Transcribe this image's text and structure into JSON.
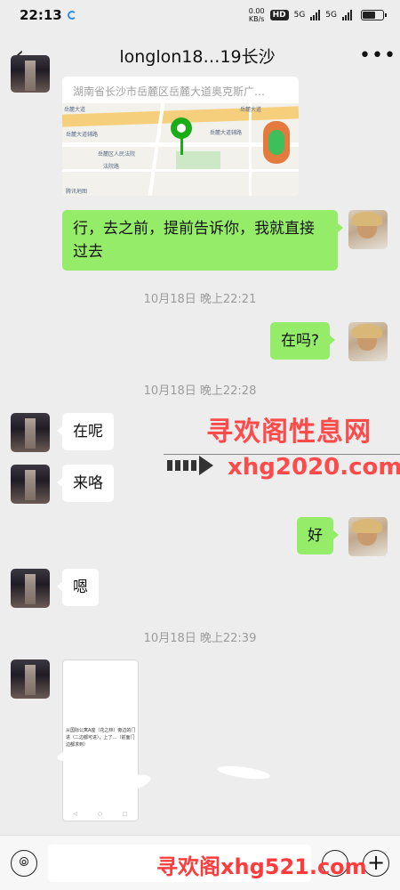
{
  "status_bar": {
    "time": "22:13",
    "net_speed_value": "0.00",
    "net_speed_unit": "KB/s",
    "hd_badge": "HD",
    "sim1": "5G",
    "sim2": "5G"
  },
  "header": {
    "back_icon": "chevron-left-icon",
    "title": "longlon18…19长沙",
    "more_icon": "more-dots-icon"
  },
  "messages": {
    "location": {
      "address": "湖南省长沙市岳麓区岳麓大道奥克斯广…"
    },
    "m1": "行，去之前，提前告诉你，我就直接过去",
    "t1": "10月18日 晚上22:21",
    "m2": "在吗?",
    "t2": "10月18日 晚上22:28",
    "m3": "在呢",
    "m4": "来咯",
    "m5": "好",
    "m6": "嗯",
    "t3": "10月18日 晚上22:39",
    "image_text": "从国际公寓A座（花之林）旁边的门进（二边都可进），上了…（前面门边都求到）"
  },
  "map_labels": {
    "l1": "岳麓大道",
    "l2": "岳麓大道",
    "l3": "岳麓大道辅路",
    "l4": "岳麓大道辅路",
    "l5": "岳麓区人民法院",
    "l6": "法院路",
    "l7": "腾讯地图"
  },
  "watermarks": {
    "title": "寻欢阁性息网",
    "url": "xhg2020.com",
    "bottom": "寻欢阁xhg521.com"
  },
  "colors": {
    "my_bubble": "#95ec69",
    "their_bubble": "#ffffff",
    "background": "#ededed",
    "watermark": "#ff4a4a"
  }
}
